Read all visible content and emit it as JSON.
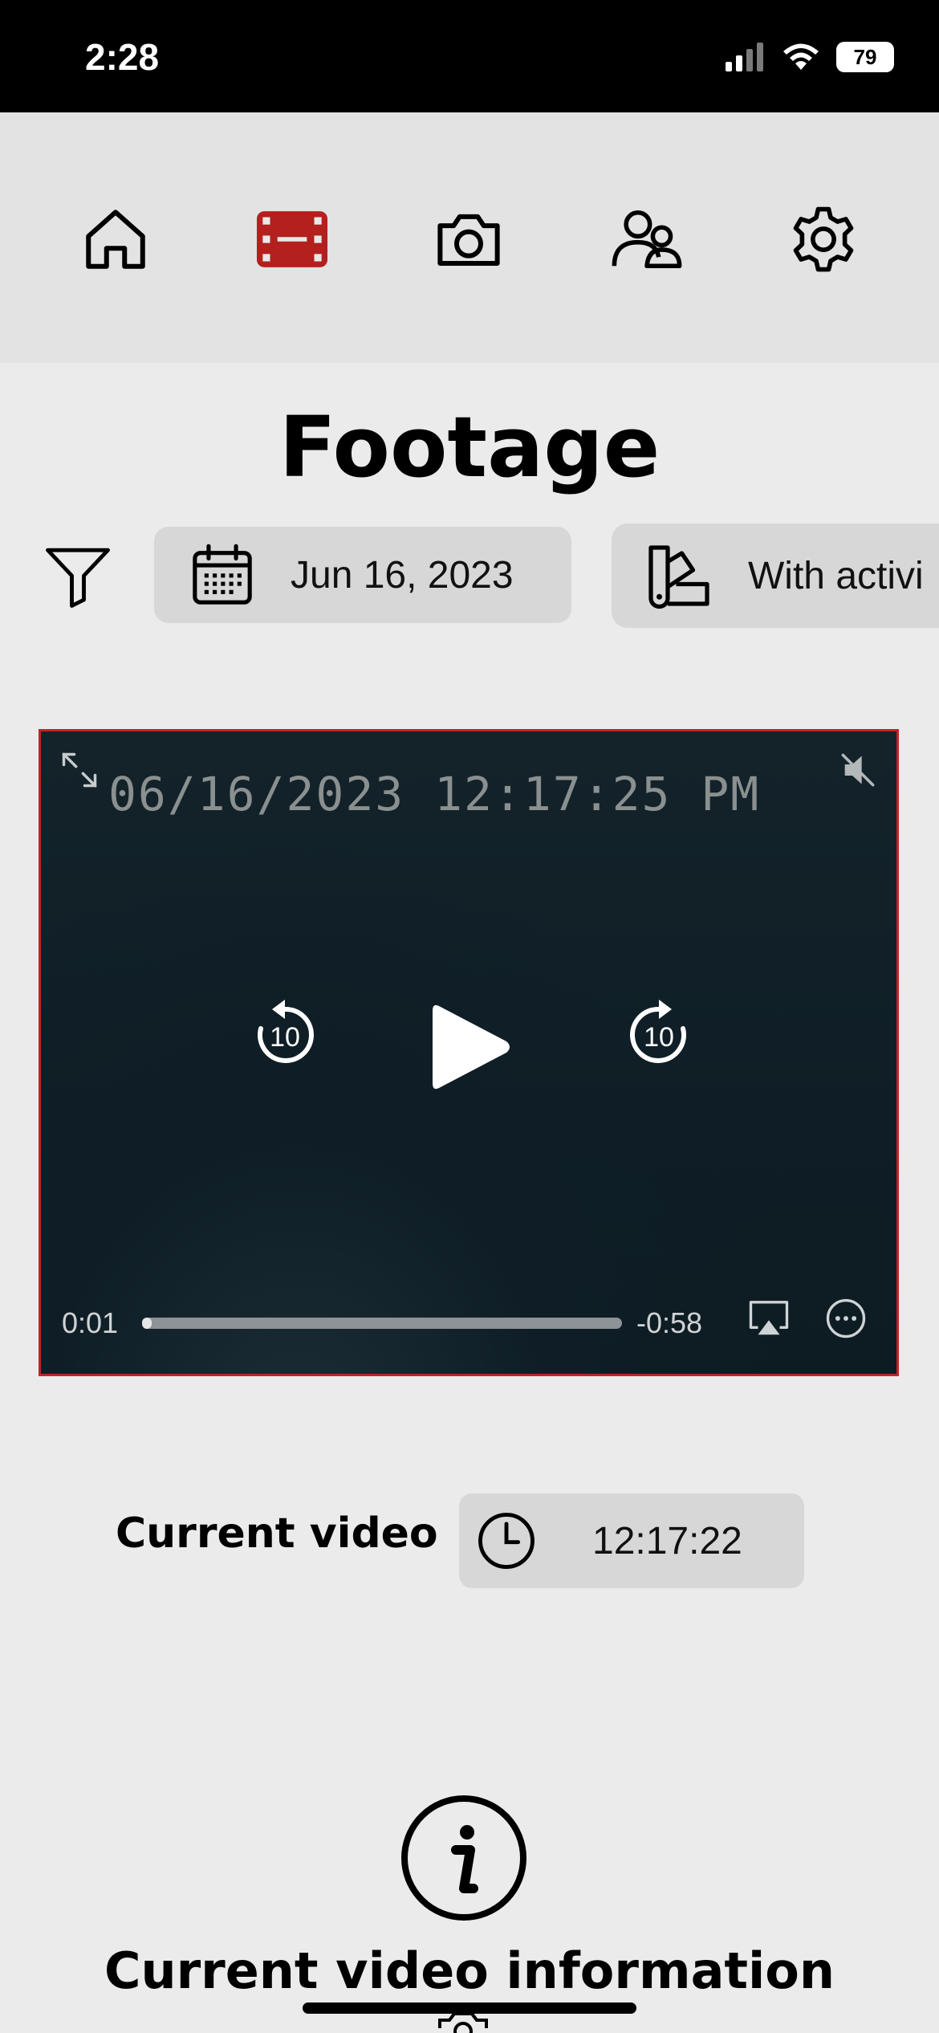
{
  "status_bar": {
    "time": "2:28",
    "battery": "79"
  },
  "nav": {
    "items": [
      {
        "icon": "home-icon",
        "active": false
      },
      {
        "icon": "film-icon",
        "active": true
      },
      {
        "icon": "camera-icon",
        "active": false
      },
      {
        "icon": "users-icon",
        "active": false
      },
      {
        "icon": "gear-icon",
        "active": false
      }
    ],
    "active_color": "#b3201e"
  },
  "page": {
    "title": "Footage"
  },
  "filters": {
    "filter_icon": "filter-icon",
    "date_chip": {
      "icon": "calendar-icon",
      "label": "Jun 16, 2023"
    },
    "activity_chip": {
      "icon": "swatch-icon",
      "label": "With activi"
    }
  },
  "video": {
    "overlay_timestamp": "06/16/2023  12:17:25 PM",
    "elapsed": "0:01",
    "remaining": "-0:58",
    "progress": 0.005,
    "skip_back_seconds": "10",
    "skip_forward_seconds": "10",
    "muted": true,
    "border_color": "#c02424"
  },
  "current_video": {
    "label": "Current video",
    "time": "12:17:22"
  },
  "info_section": {
    "title": "Current video information",
    "icon": "info-icon"
  }
}
